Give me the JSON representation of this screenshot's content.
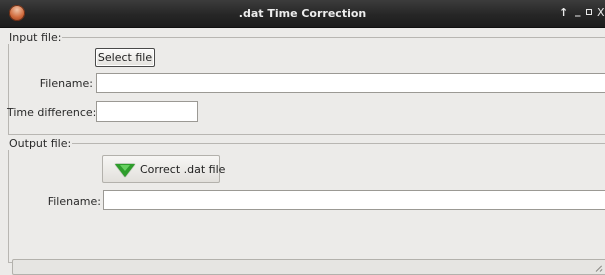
{
  "window": {
    "title": ".dat Time Correction",
    "controls": {
      "up": "↑",
      "minimize": "_",
      "maximize": "□",
      "close": "X"
    }
  },
  "input_group": {
    "title": "Input file:",
    "select_button": "Select file",
    "filename_label": "Filename:",
    "filename_value": "",
    "time_difference_label": "Time difference:",
    "time_difference_value": ""
  },
  "output_group": {
    "title": "Output file:",
    "correct_button": "Correct .dat file",
    "correct_icon": "green-down-triangle-icon",
    "filename_label": "Filename:",
    "filename_value": ""
  },
  "colors": {
    "titlebar": "#262626",
    "accent_icon": "#2e9d2c",
    "background": "#ecebe9"
  }
}
